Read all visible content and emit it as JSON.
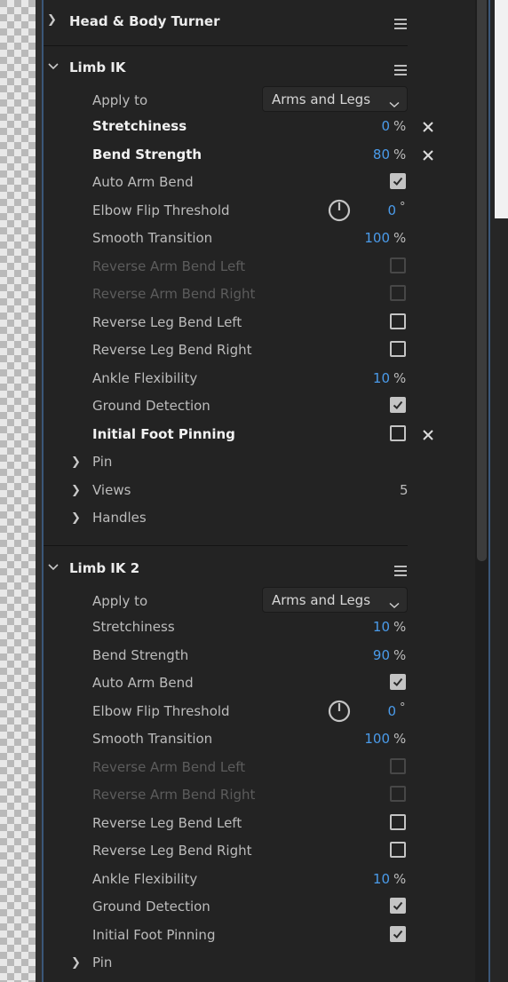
{
  "colors": {
    "accent": "#4a9bea",
    "panel_bg": "#232323",
    "text": "#bcbcbc",
    "disabled_text": "#5c5c5c"
  },
  "groups": [
    {
      "title": "Head & Body Turner"
    },
    {
      "title": "Limb IK",
      "apply_to": {
        "label": "Apply to",
        "value": "Arms and Legs"
      },
      "stretchiness": {
        "label": "Stretchiness",
        "value": "0",
        "unit": "%"
      },
      "bend_strength": {
        "label": "Bend Strength",
        "value": "80",
        "unit": "%"
      },
      "auto_arm_bend": {
        "label": "Auto Arm Bend",
        "checked": true
      },
      "elbow_flip": {
        "label": "Elbow Flip Threshold",
        "value": "0",
        "unit": "°"
      },
      "smooth_transition": {
        "label": "Smooth Transition",
        "value": "100",
        "unit": "%"
      },
      "reverse_arm_left": {
        "label": "Reverse Arm Bend Left",
        "checked": false,
        "disabled": true
      },
      "reverse_arm_right": {
        "label": "Reverse Arm Bend Right",
        "checked": false,
        "disabled": true
      },
      "reverse_leg_left": {
        "label": "Reverse Leg Bend Left",
        "checked": false
      },
      "reverse_leg_right": {
        "label": "Reverse Leg Bend Right",
        "checked": false
      },
      "ankle_flex": {
        "label": "Ankle Flexibility",
        "value": "10",
        "unit": "%"
      },
      "ground_detection": {
        "label": "Ground Detection",
        "checked": true
      },
      "initial_foot_pinning": {
        "label": "Initial Foot Pinning",
        "checked": false
      },
      "pin": {
        "label": "Pin"
      },
      "views": {
        "label": "Views",
        "count": "5"
      },
      "handles": {
        "label": "Handles"
      }
    },
    {
      "title": "Limb IK 2",
      "apply_to": {
        "label": "Apply to",
        "value": "Arms and Legs"
      },
      "stretchiness": {
        "label": "Stretchiness",
        "value": "10",
        "unit": "%"
      },
      "bend_strength": {
        "label": "Bend Strength",
        "value": "90",
        "unit": "%"
      },
      "auto_arm_bend": {
        "label": "Auto Arm Bend",
        "checked": true
      },
      "elbow_flip": {
        "label": "Elbow Flip Threshold",
        "value": "0",
        "unit": "°"
      },
      "smooth_transition": {
        "label": "Smooth Transition",
        "value": "100",
        "unit": "%"
      },
      "reverse_arm_left": {
        "label": "Reverse Arm Bend Left",
        "checked": false,
        "disabled": true
      },
      "reverse_arm_right": {
        "label": "Reverse Arm Bend Right",
        "checked": false,
        "disabled": true
      },
      "reverse_leg_left": {
        "label": "Reverse Leg Bend Left",
        "checked": false
      },
      "reverse_leg_right": {
        "label": "Reverse Leg Bend Right",
        "checked": false
      },
      "ankle_flex": {
        "label": "Ankle Flexibility",
        "value": "10",
        "unit": "%"
      },
      "ground_detection": {
        "label": "Ground Detection",
        "checked": true
      },
      "initial_foot_pinning": {
        "label": "Initial Foot Pinning",
        "checked": true
      },
      "pin": {
        "label": "Pin"
      }
    }
  ]
}
